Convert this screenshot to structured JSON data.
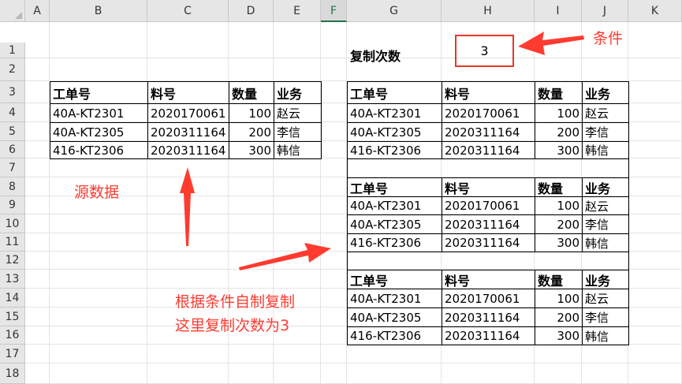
{
  "columns": [
    "A",
    "B",
    "C",
    "D",
    "E",
    "F",
    "G",
    "H",
    "I",
    "J",
    "K"
  ],
  "rows": [
    "1",
    "2",
    "3",
    "4",
    "5",
    "6",
    "7",
    "8",
    "9",
    "10",
    "11",
    "12",
    "13",
    "14",
    "15",
    "16",
    "17",
    "18"
  ],
  "selected_column": "F",
  "copy_label": "复制次数",
  "copy_count": "3",
  "source_table": {
    "headers": [
      "工单号",
      "料号",
      "数量",
      "业务"
    ],
    "rows": [
      [
        "40A-KT2301",
        "2020170061",
        "100",
        "赵云"
      ],
      [
        "40A-KT2305",
        "2020311164",
        "200",
        "李信"
      ],
      [
        "416-KT2306",
        "2020311164",
        "300",
        "韩信"
      ]
    ]
  },
  "annotations": {
    "condition": "条件",
    "source": "源数据",
    "note_line1": "根据条件自制复制",
    "note_line2": "这里复制次数为3"
  },
  "colors": {
    "accent_red": "#ff3b30",
    "selected_col": "#207245"
  }
}
